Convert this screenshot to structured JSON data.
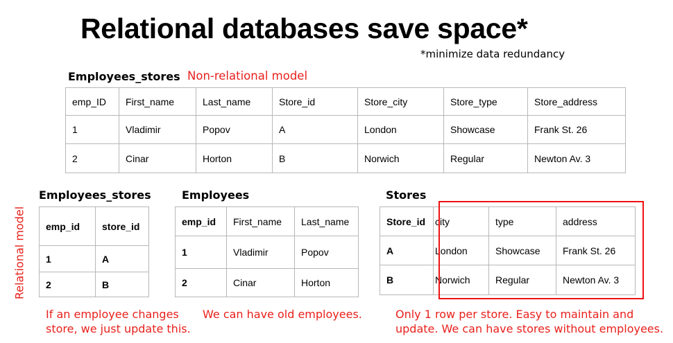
{
  "slide": {
    "title": "Relational databases save space*",
    "footnote": "*minimize data redundancy",
    "relational_label": "Relational model"
  },
  "top_table": {
    "name": "Employees_stores",
    "tag": "Non-relational model",
    "headers": [
      "emp_ID",
      "First_name",
      "Last_name",
      "Store_id",
      "Store_city",
      "Store_type",
      "Store_address"
    ],
    "rows": [
      [
        "1",
        "Vladimir",
        "Popov",
        "A",
        "London",
        "Showcase",
        "Frank St. 26"
      ],
      [
        "2",
        "Cinar",
        "Horton",
        "B",
        "Norwich",
        "Regular",
        "Newton Av. 3"
      ]
    ]
  },
  "emp_stores_table": {
    "name": "Employees_stores",
    "headers": [
      "emp_id",
      "store_id"
    ],
    "rows": [
      [
        "1",
        "A"
      ],
      [
        "2",
        "B"
      ]
    ],
    "note": "If an employee changes store, we just update this."
  },
  "employees_table": {
    "name": "Employees",
    "headers": [
      "emp_id",
      "First_name",
      "Last_name"
    ],
    "rows": [
      [
        "1",
        "Vladimir",
        "Popov"
      ],
      [
        "2",
        "Cinar",
        "Horton"
      ]
    ],
    "note": "We can have old employees."
  },
  "stores_table": {
    "name": "Stores",
    "headers": [
      "Store_id",
      "city",
      "type",
      "address"
    ],
    "rows": [
      [
        "A",
        "London",
        "Showcase",
        "Frank St. 26"
      ],
      [
        "B",
        "Norwich",
        "Regular",
        "Newton Av. 3"
      ]
    ],
    "note": "Only 1 row per store. Easy to maintain and update. We can have stores without employees."
  },
  "colors": {
    "annotation_red": "#e8211c",
    "grid_border": "#b7b7b7",
    "highlight_box": "#ee1111"
  }
}
